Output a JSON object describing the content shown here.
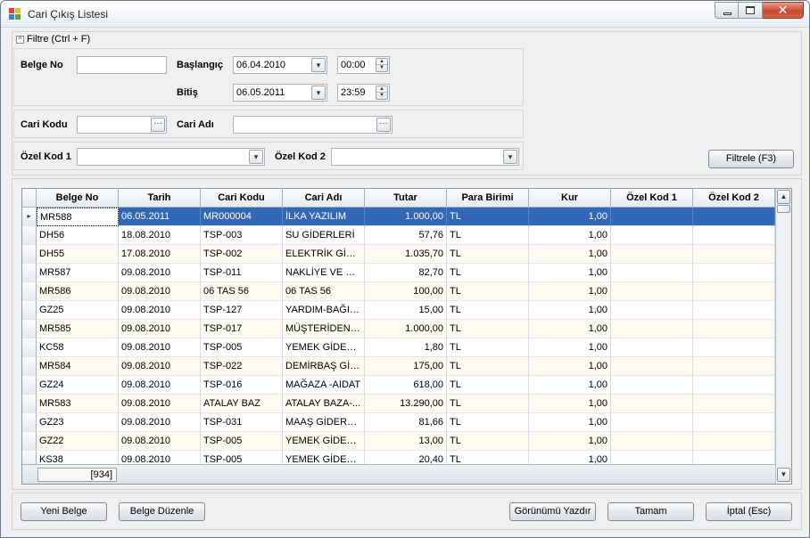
{
  "window": {
    "title": "Cari Çıkış Listesi",
    "close_glyph": "✕"
  },
  "filter": {
    "toggle": "^",
    "title": "Filtre (Ctrl + F)",
    "belge_no_label": "Belge No",
    "belge_no_value": "",
    "baslangic_label": "Başlangıç",
    "baslangic_date": "06.04.2010",
    "baslangic_time": "00:00",
    "bitis_label": "Bitiş",
    "bitis_date": "06.05.2011",
    "bitis_time": "23:59",
    "cari_kodu_label": "Cari Kodu",
    "cari_kodu_value": "",
    "cari_adi_label": "Cari Adı",
    "cari_adi_value": "",
    "ozel_kod1_label": "Özel Kod 1",
    "ozel_kod1_value": "",
    "ozel_kod2_label": "Özel Kod 2",
    "ozel_kod2_value": "",
    "filtrele_label": "Filtrele (F3)"
  },
  "grid": {
    "columns": [
      "Belge No",
      "Tarih",
      "Cari Kodu",
      "Cari Adı",
      "Tutar",
      "Para Birimi",
      "Kur",
      "Özel Kod 1",
      "Özel Kod 2"
    ],
    "rows": [
      [
        "MR588",
        "06.05.2011",
        "MR000004",
        "İLKA YAZILIM",
        "1.000,00",
        "TL",
        "1,00",
        "",
        ""
      ],
      [
        "DH56",
        "18.08.2010",
        "TSP-003",
        "SU GİDERLERİ",
        "57,76",
        "TL",
        "1,00",
        "",
        ""
      ],
      [
        "DH55",
        "17.08.2010",
        "TSP-002",
        "ELEKTRİK GİDE...",
        "1.035,70",
        "TL",
        "1,00",
        "",
        ""
      ],
      [
        "MR587",
        "09.08.2010",
        "TSP-011",
        "NAKLİYE VE KA...",
        "82,70",
        "TL",
        "1,00",
        "",
        ""
      ],
      [
        "MR586",
        "09.08.2010",
        "06 TAS 56",
        "06 TAS 56",
        "100,00",
        "TL",
        "1,00",
        "",
        ""
      ],
      [
        "GZ25",
        "09.08.2010",
        "TSP-127",
        "YARDIM-BAĞIŞ...",
        "15,00",
        "TL",
        "1,00",
        "",
        ""
      ],
      [
        "MR585",
        "09.08.2010",
        "TSP-017",
        "MÜŞTERİDEN T...",
        "1.000,00",
        "TL",
        "1,00",
        "",
        ""
      ],
      [
        "KC58",
        "09.08.2010",
        "TSP-005",
        "YEMEK GİDERL...",
        "1,80",
        "TL",
        "1,00",
        "",
        ""
      ],
      [
        "MR584",
        "09.08.2010",
        "TSP-022",
        "DEMİRBAŞ GİD...",
        "175,00",
        "TL",
        "1,00",
        "",
        ""
      ],
      [
        "GZ24",
        "09.08.2010",
        "TSP-016",
        "MAĞAZA -AIDAT",
        "618,00",
        "TL",
        "1,00",
        "",
        ""
      ],
      [
        "MR583",
        "09.08.2010",
        "ATALAY BAZ",
        "ATALAY BAZA-...",
        "13.290,00",
        "TL",
        "1,00",
        "",
        ""
      ],
      [
        "GZ23",
        "09.08.2010",
        "TSP-031",
        "MAAŞ GİDERLERİ",
        "81,66",
        "TL",
        "1,00",
        "",
        ""
      ],
      [
        "GZ22",
        "09.08.2010",
        "TSP-005",
        "YEMEK GİDERL...",
        "13,00",
        "TL",
        "1,00",
        "",
        ""
      ],
      [
        "KS38",
        "09.08.2010",
        "TSP-005",
        "YEMEK GİDERL...",
        "20,40",
        "TL",
        "1,00",
        "",
        ""
      ]
    ],
    "record_count": "[934]",
    "row_indicator": "▸"
  },
  "buttons": {
    "yeni_belge": "Yeni Belge",
    "belge_duzenle": "Belge Düzenle",
    "gorunumu_yazdir": "Görünümü Yazdır",
    "tamam": "Tamam",
    "iptal": "İptal (Esc)"
  },
  "glyphs": {
    "dropdown": "▾",
    "ellipsis": "···",
    "spin_up": "▲",
    "spin_down": "▼",
    "scroll_up": "▲",
    "scroll_down": "▼"
  }
}
